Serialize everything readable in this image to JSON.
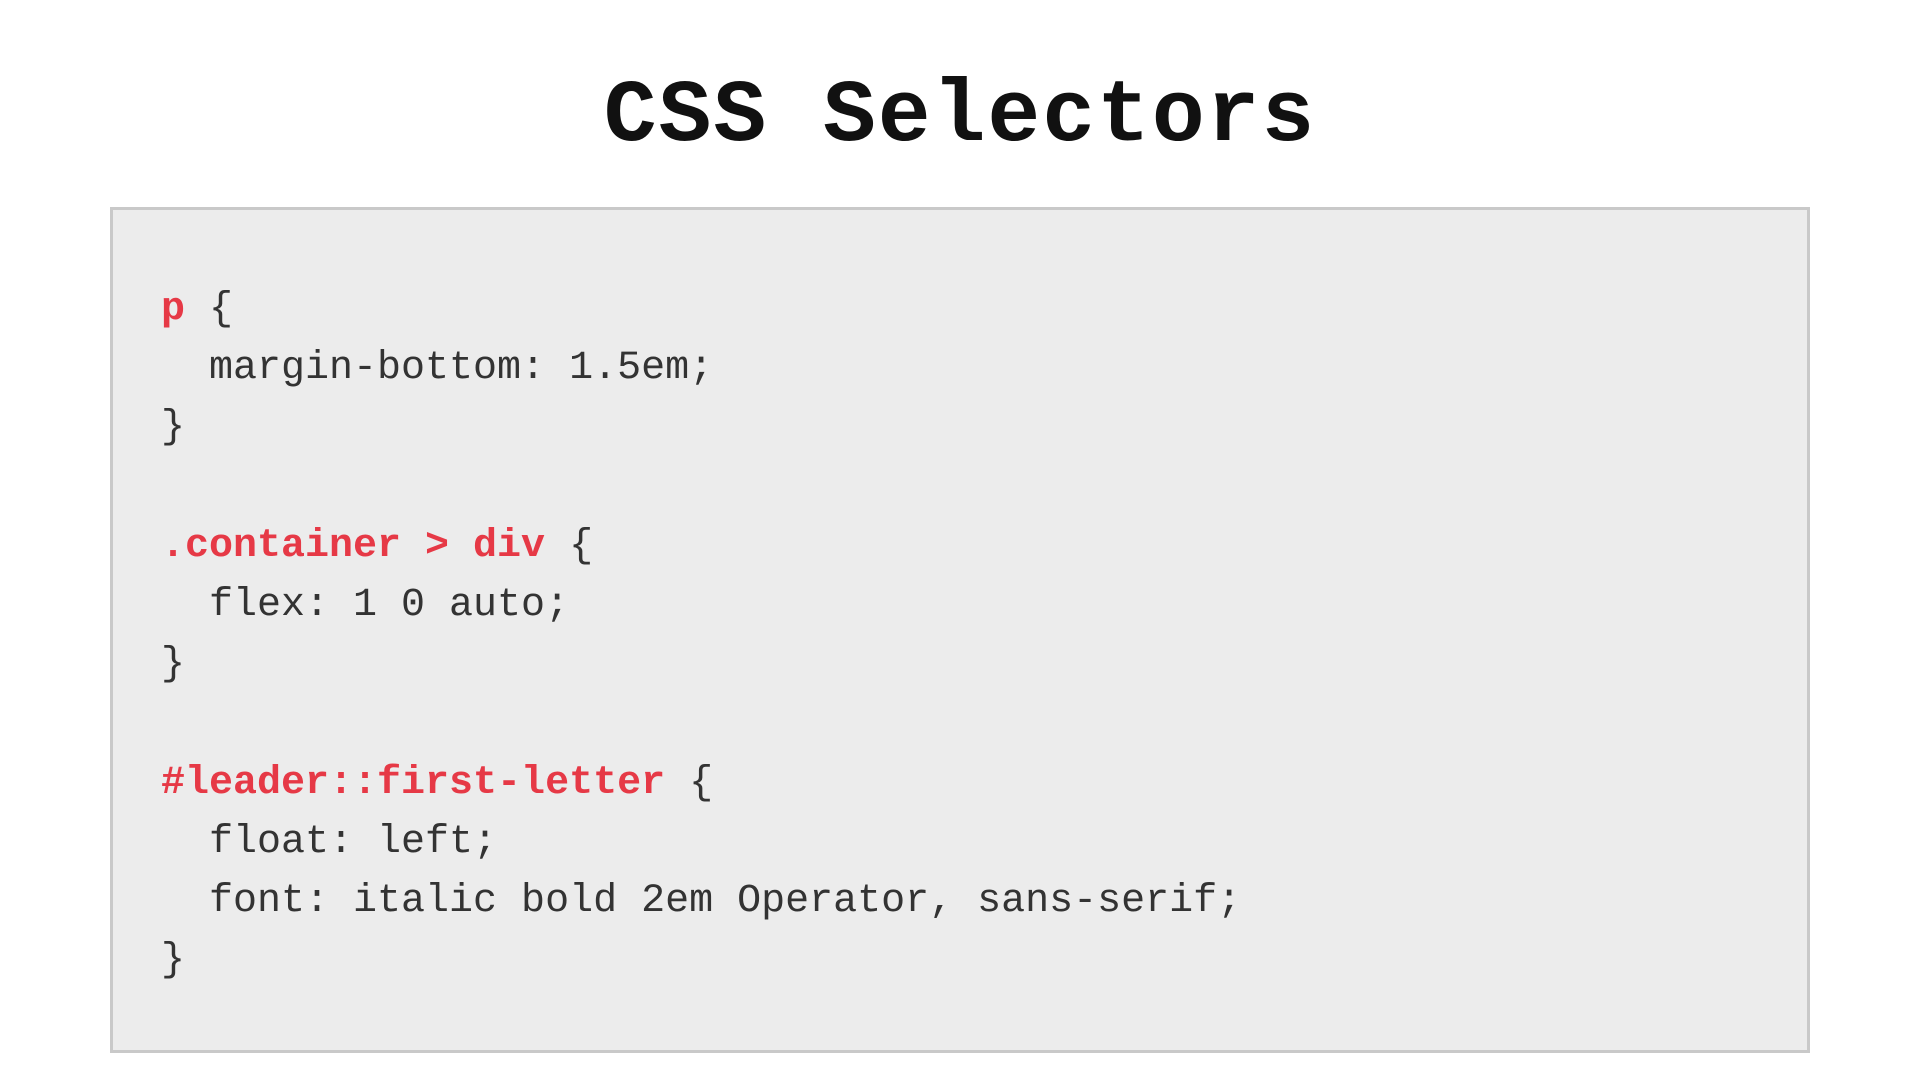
{
  "title": "CSS Selectors",
  "colors": {
    "selector": "#e63946",
    "text": "#333333",
    "box_bg": "#ececec",
    "box_border": "#c9c9c9"
  },
  "code": {
    "rules": [
      {
        "selector": "p",
        "open": " {",
        "body": [
          "  margin-bottom: 1.5em;"
        ],
        "close": "}"
      },
      {
        "selector": ".container > div",
        "open": " {",
        "body": [
          "  flex: 1 0 auto;"
        ],
        "close": "}"
      },
      {
        "selector": "#leader::first-letter",
        "open": " {",
        "body": [
          "  float: left;",
          "  font: italic bold 2em Operator, sans-serif;"
        ],
        "close": "}"
      }
    ]
  }
}
